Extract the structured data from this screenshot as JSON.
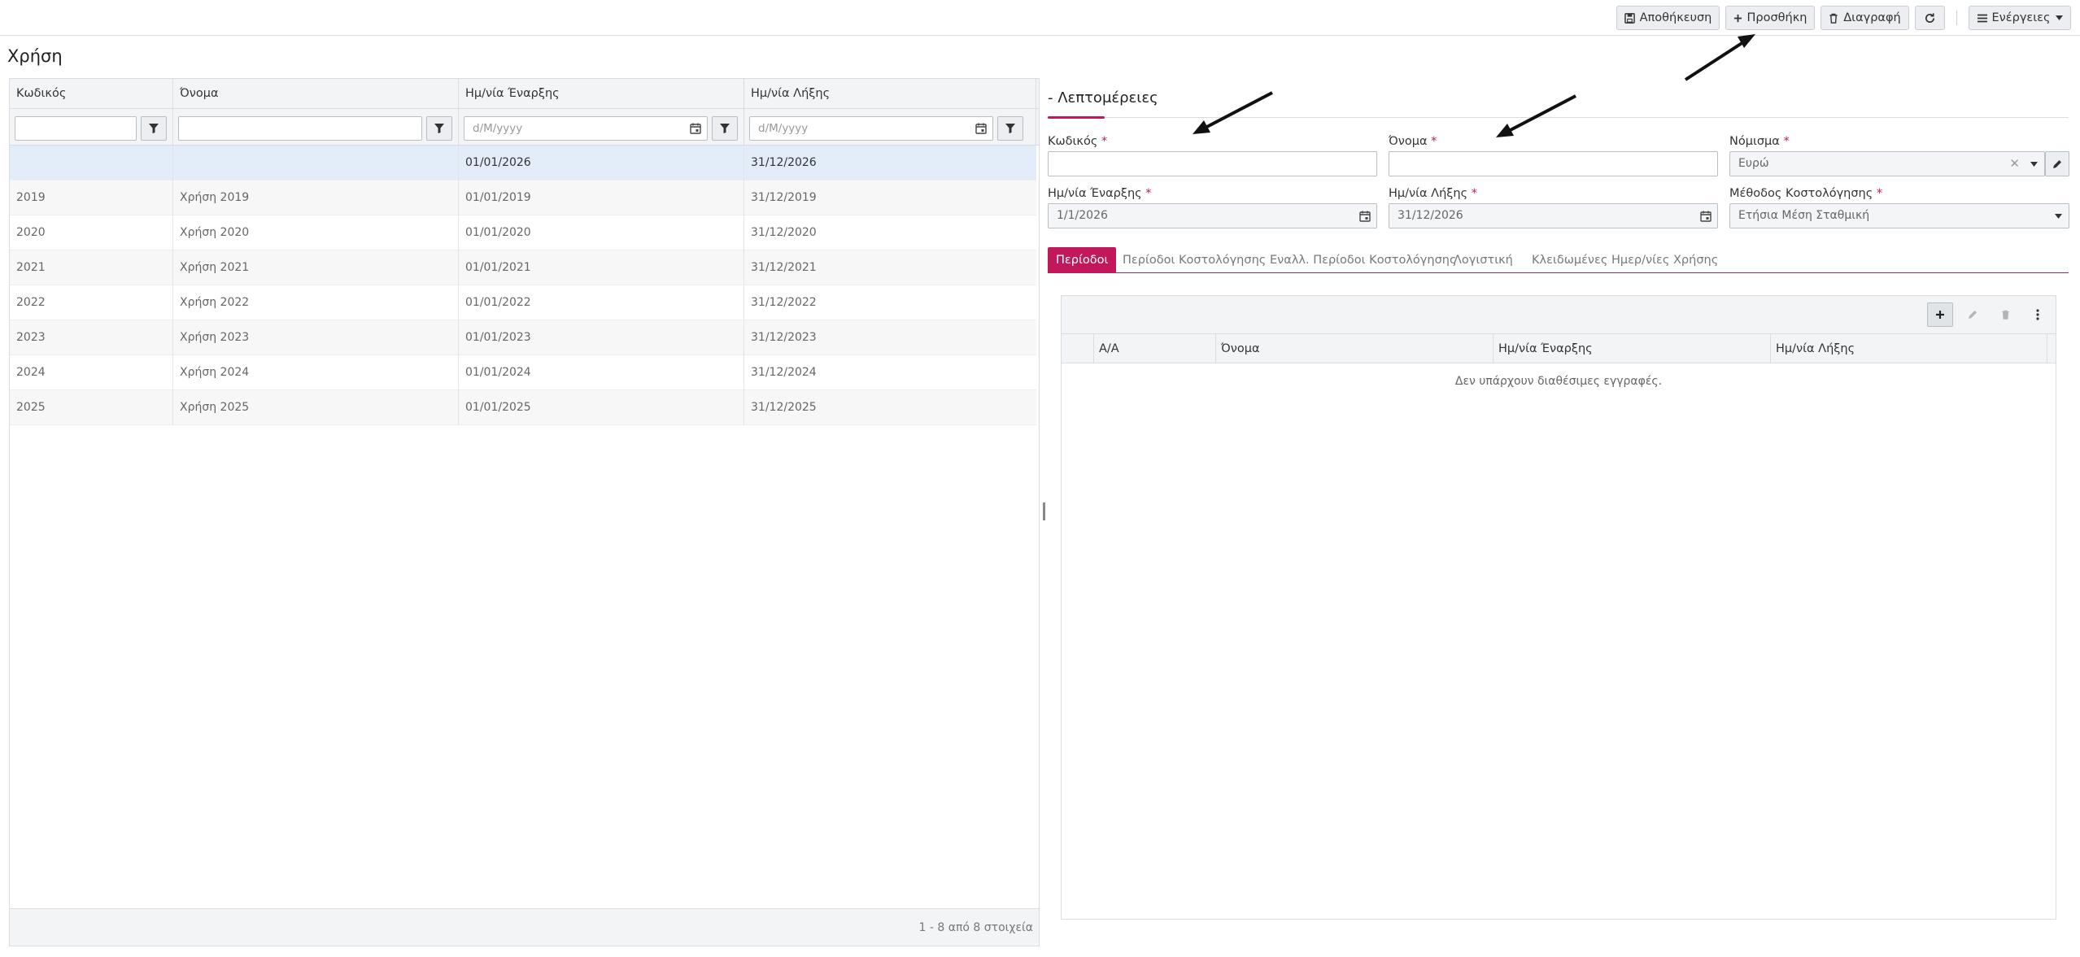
{
  "toolbar": {
    "save_label": "Αποθήκευση",
    "add_label": "Προσθήκη",
    "delete_label": "Διαγραφή",
    "actions_label": "Ενέργειες"
  },
  "page": {
    "title": "Χρήση"
  },
  "grid": {
    "columns": [
      "Κωδικός",
      "Όνομα",
      "Ημ/νία Έναρξης",
      "Ημ/νία Λήξης"
    ],
    "filter_placeholders": {
      "start": "d/M/yyyy",
      "end": "d/M/yyyy"
    },
    "rows": [
      [
        "",
        "",
        "01/01/2026",
        "31/12/2026"
      ],
      [
        "2019",
        "Χρήση 2019",
        "01/01/2019",
        "31/12/2019"
      ],
      [
        "2020",
        "Χρήση 2020",
        "01/01/2020",
        "31/12/2020"
      ],
      [
        "2021",
        "Χρήση 2021",
        "01/01/2021",
        "31/12/2021"
      ],
      [
        "2022",
        "Χρήση 2022",
        "01/01/2022",
        "31/12/2022"
      ],
      [
        "2023",
        "Χρήση 2023",
        "01/01/2023",
        "31/12/2023"
      ],
      [
        "2024",
        "Χρήση 2024",
        "01/01/2024",
        "31/12/2024"
      ],
      [
        "2025",
        "Χρήση 2025",
        "01/01/2025",
        "31/12/2025"
      ]
    ],
    "pager": "1 - 8 από 8 στοιχεία"
  },
  "detail": {
    "title": "- Λεπτομέρειες",
    "fields": {
      "code_label": "Κωδικός",
      "code_value": "",
      "name_label": "Όνομα",
      "name_value": "",
      "currency_label": "Νόμισμα",
      "currency_value": "Ευρώ",
      "start_label": "Ημ/νία Έναρξης",
      "start_value": "1/1/2026",
      "end_label": "Ημ/νία Λήξης",
      "end_value": "31/12/2026",
      "costing_label": "Μέθοδος Κοστολόγησης",
      "costing_value": "Ετήσια Μέση Σταθμική"
    },
    "required_mark": "*",
    "tabs": [
      "Περίοδοι",
      "Περίοδοι Κοστολόγησης",
      "Εναλλ. Περίοδοι Κοστολόγησης",
      "Λογιστική",
      "Κλειδωμένες Ημερ/νίες Χρήσης"
    ],
    "periods": {
      "columns": [
        "Α/Α",
        "Όνομα",
        "Ημ/νία Έναρξης",
        "Ημ/νία Λήξης"
      ],
      "empty_message": "Δεν υπάρχουν διαθέσιμες εγγραφές."
    }
  },
  "colors": {
    "accent": "#c2185b",
    "selected_row": "#e3edf9"
  },
  "icons": [
    "save-icon",
    "plus-icon",
    "trash-icon",
    "refresh-icon",
    "menu-icon",
    "caret-down-icon",
    "filter-icon",
    "calendar-icon",
    "clear-icon",
    "edit-icon",
    "more-vertical-icon",
    "arrow-annotation"
  ]
}
